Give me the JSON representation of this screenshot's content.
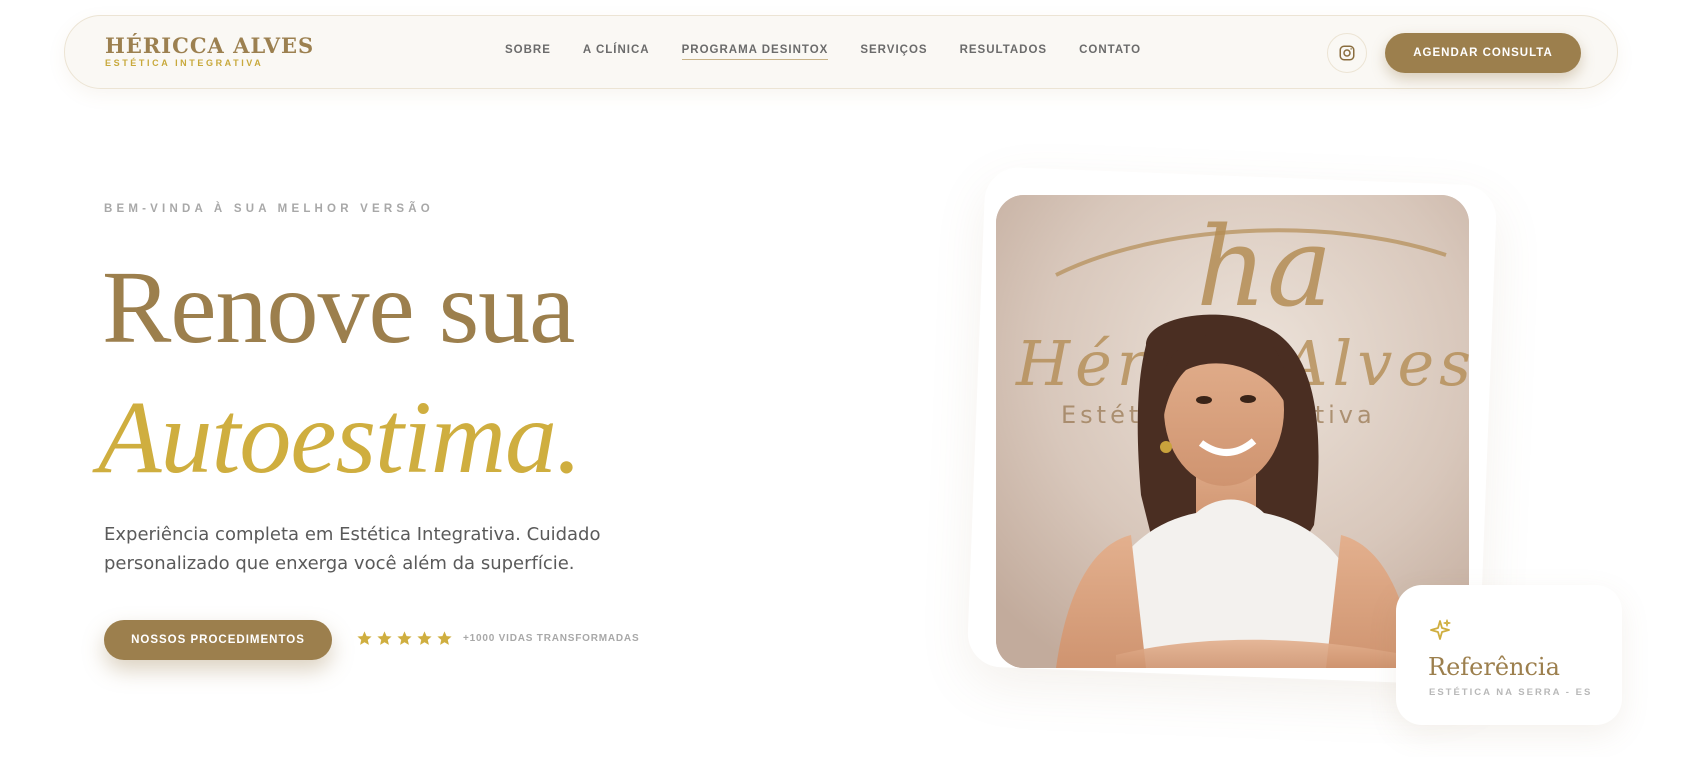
{
  "header": {
    "brand_name": "HÉRICCA ALVES",
    "brand_sub": "ESTÉTICA INTEGRATIVA",
    "menu": [
      {
        "label": "SOBRE"
      },
      {
        "label": "A CLÍNICA"
      },
      {
        "label": "PROGRAMA DESINTOX",
        "active": true
      },
      {
        "label": "SERVIÇOS"
      },
      {
        "label": "RESULTADOS"
      },
      {
        "label": "CONTATO"
      }
    ],
    "instagram_icon": "instagram-icon",
    "cta_label": "AGENDAR CONSULTA"
  },
  "hero": {
    "eyebrow": "BEM-VINDA À SUA MELHOR VERSÃO",
    "title_line1": "Renove sua",
    "title_line2": "Autoestima.",
    "description": "Experiência completa em Estética Integrativa. Cuidado personalizado que enxerga você além da superfície.",
    "cta_label": "NOSSOS PROCEDIMENTOS",
    "rating_stars": 5,
    "rating_text": "+1000 VIDAS TRANSFORMADAS"
  },
  "photo": {
    "wall_sign_ha": "ha",
    "wall_sign_name": "Hérica Alves",
    "wall_sign_sub": "Estética Integrativa"
  },
  "reference_card": {
    "icon": "sparkle-icon",
    "title": "Referência",
    "subtitle": "ESTÉTICA NA SERRA - ES"
  },
  "colors": {
    "brand_brown": "#9c7f4d",
    "brand_gold": "#cfae3f",
    "nav_bg": "#faf8f4"
  }
}
